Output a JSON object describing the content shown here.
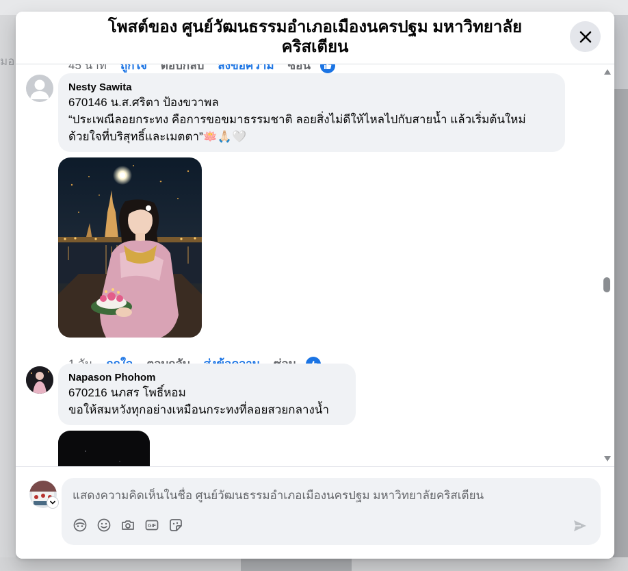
{
  "background": {
    "left_fragment": "มอ"
  },
  "modal": {
    "title": "โพสต์ของ ศูนย์วัฒนธรรมอำเภอเมืองนครปฐม มหาวิทยาลัยคริสเตียน",
    "close_icon": "close-icon"
  },
  "prev_meta": {
    "time": "45 นาที",
    "like": "ถูกใจ",
    "reply": "ตอบกลับ",
    "message": "ส่งข้อความ",
    "hide": "ซ่อน"
  },
  "comments": [
    {
      "author": "Nesty Sawita",
      "line1": "670146 น.ส.ศริตา ป้องขวาพล",
      "line2": "“ประเพณีลอยกระทง คือการขอขมาธรรมชาติ ลอยสิ่งไม่ดีให้ไหลไปกับสายน้ำ แล้วเริ่มต้นใหม่",
      "line3": "ด้วยใจที่บริสุทธิ์และเมตตา”🪷🙏🏻🤍",
      "photo": "Woman in pink Thai dress holding krathong at night by temple",
      "meta": {
        "time": "1 วัน",
        "like": "ถูกใจ",
        "reply": "ตอบกลับ",
        "message": "ส่งข้อความ",
        "hide": "ซ่อน"
      }
    },
    {
      "author": "Napason Phohom",
      "line1": "670216 นภสร โพธิ์หอม",
      "line2": "ขอให้สมหวังทุกอย่างเหมือนกระทงที่ลอยสวยกลางน้ำ",
      "photo": "Dark night photo"
    }
  ],
  "composer": {
    "placeholder": "แสดงความคิดเห็นในชื่อ ศูนย์วัฒนธรรมอำเภอเมืองนครปฐม มหาวิทยาลัยคริสเตียน",
    "tools": [
      "avatar-sticker-icon",
      "emoji-icon",
      "camera-icon",
      "gif-icon",
      "sticker-icon"
    ],
    "send_icon": "send-icon"
  }
}
